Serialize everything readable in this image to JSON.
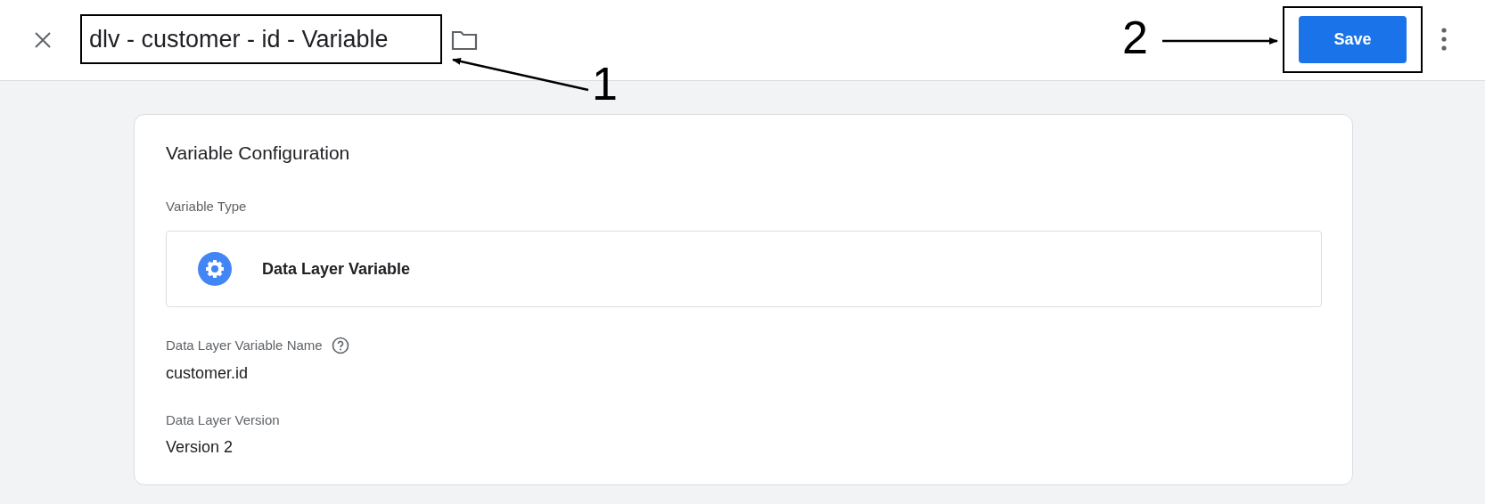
{
  "header": {
    "title": "dlv - customer - id - Variable",
    "save_button": "Save"
  },
  "card": {
    "title": "Variable Configuration",
    "type_label": "Variable Type",
    "type_value": "Data Layer Variable",
    "fields": [
      {
        "label": "Data Layer Variable Name",
        "value": "customer.id",
        "help": true
      },
      {
        "label": "Data Layer Version",
        "value": "Version 2",
        "help": false
      }
    ]
  },
  "annotations": [
    {
      "number": "1"
    },
    {
      "number": "2"
    }
  ]
}
